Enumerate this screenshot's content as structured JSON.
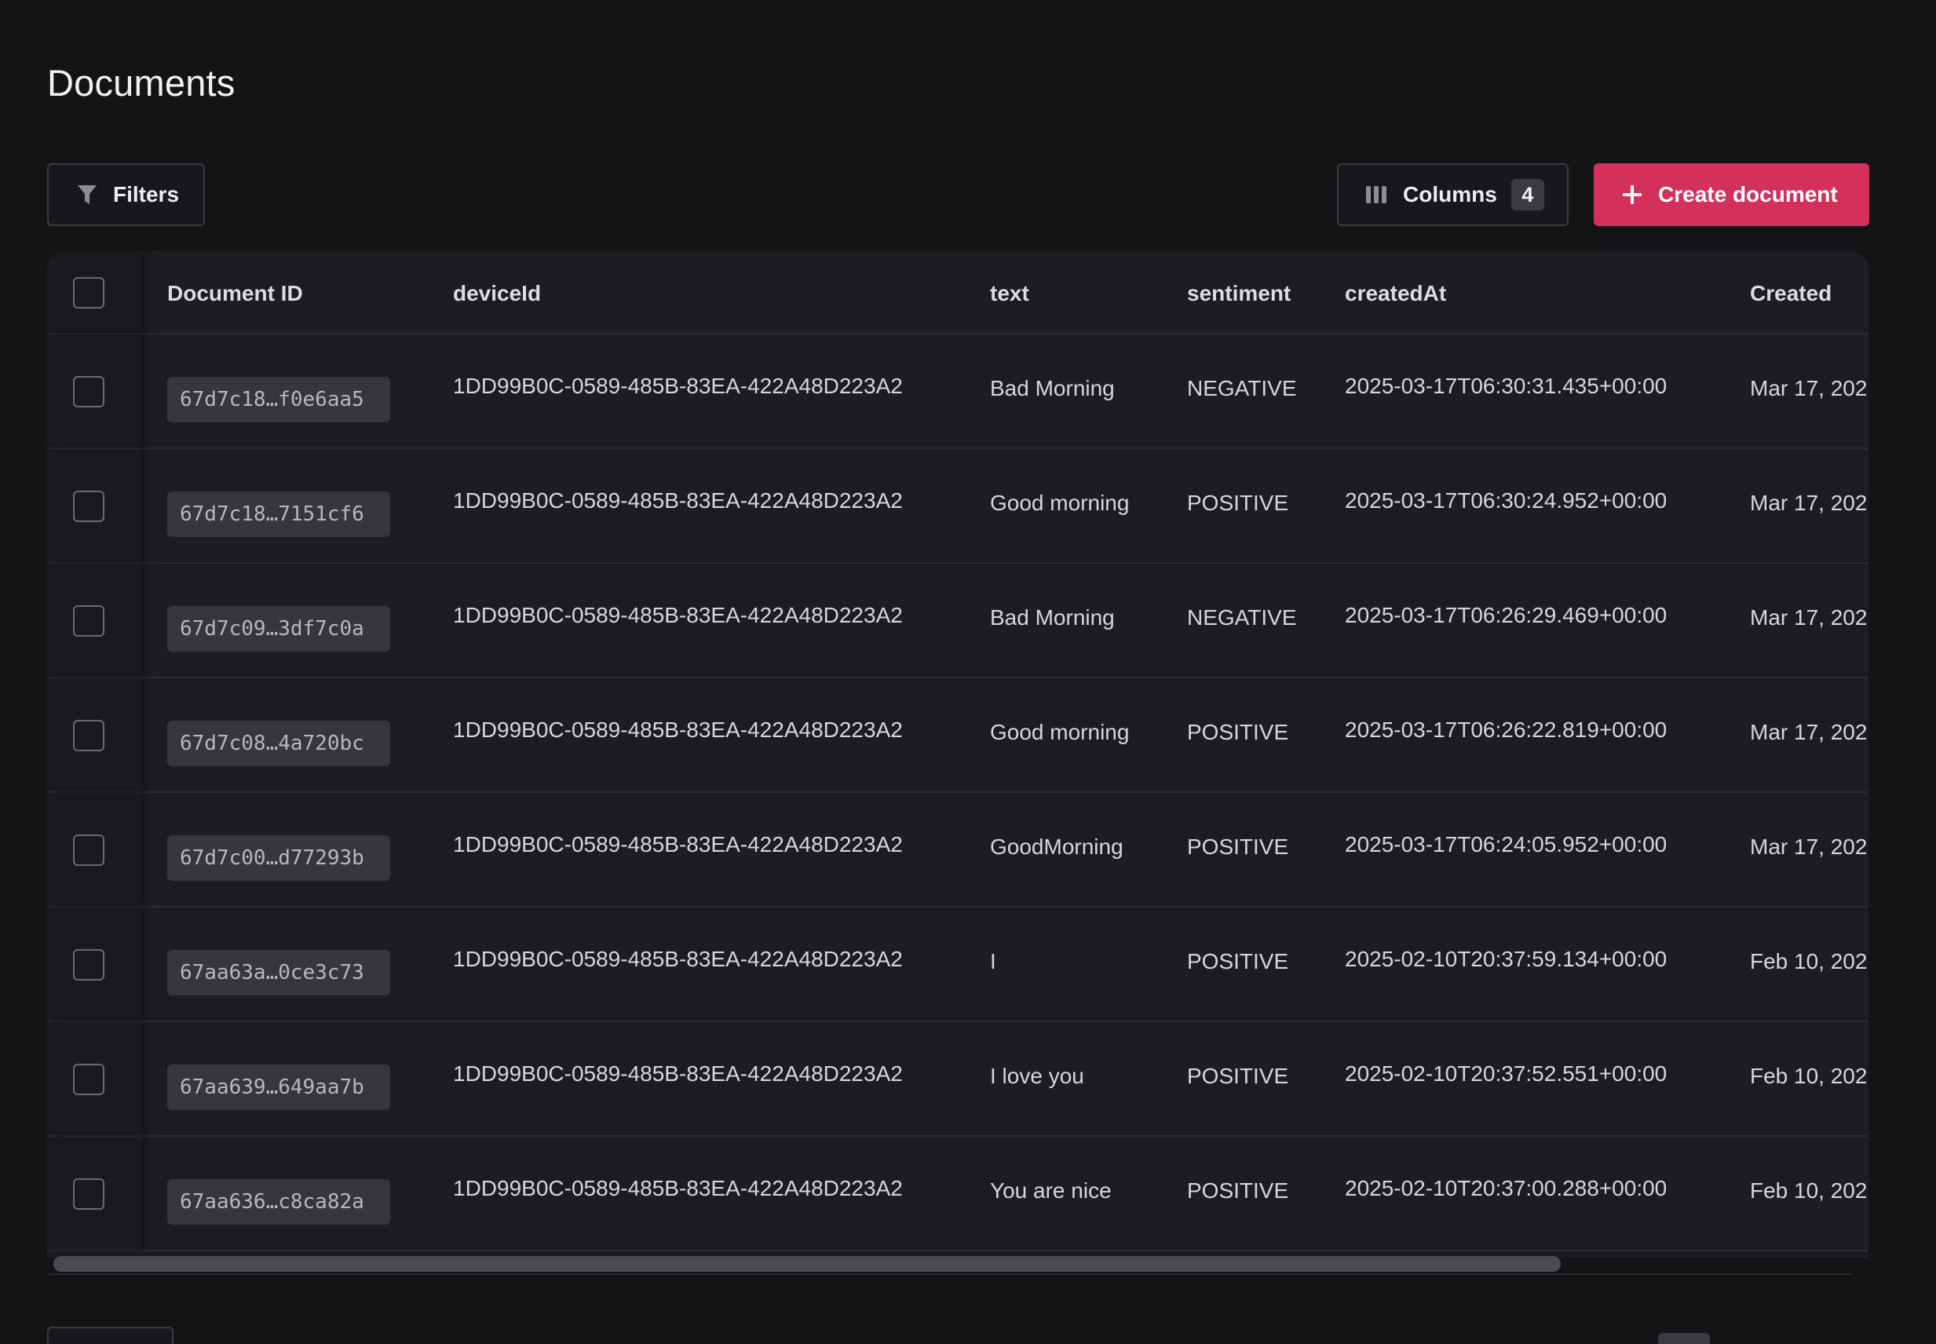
{
  "page": {
    "title": "Documents"
  },
  "toolbar": {
    "filters_label": "Filters",
    "columns_label": "Columns",
    "columns_count": "4",
    "create_label": "Create document"
  },
  "table": {
    "columns": [
      "Document ID",
      "deviceId",
      "text",
      "sentiment",
      "createdAt",
      "Created"
    ],
    "rows": [
      {
        "id": "67d7c18…f0e6aa5",
        "deviceId": "1DD99B0C-0589-485B-83EA-422A48D223A2",
        "text": "Bad Morning",
        "sentiment": "NEGATIVE",
        "createdAt": "2025-03-17T06:30:31.435+00:00",
        "created": "Mar 17, 202"
      },
      {
        "id": "67d7c18…7151cf6",
        "deviceId": "1DD99B0C-0589-485B-83EA-422A48D223A2",
        "text": "Good morning",
        "sentiment": "POSITIVE",
        "createdAt": "2025-03-17T06:30:24.952+00:00",
        "created": "Mar 17, 202"
      },
      {
        "id": "67d7c09…3df7c0a",
        "deviceId": "1DD99B0C-0589-485B-83EA-422A48D223A2",
        "text": "Bad Morning",
        "sentiment": "NEGATIVE",
        "createdAt": "2025-03-17T06:26:29.469+00:00",
        "created": "Mar 17, 202"
      },
      {
        "id": "67d7c08…4a720bc",
        "deviceId": "1DD99B0C-0589-485B-83EA-422A48D223A2",
        "text": "Good morning",
        "sentiment": "POSITIVE",
        "createdAt": "2025-03-17T06:26:22.819+00:00",
        "created": "Mar 17, 202"
      },
      {
        "id": "67d7c00…d77293b",
        "deviceId": "1DD99B0C-0589-485B-83EA-422A48D223A2",
        "text": "GoodMorning",
        "sentiment": "POSITIVE",
        "createdAt": "2025-03-17T06:24:05.952+00:00",
        "created": "Mar 17, 202"
      },
      {
        "id": "67aa63a…0ce3c73",
        "deviceId": "1DD99B0C-0589-485B-83EA-422A48D223A2",
        "text": "I",
        "sentiment": "POSITIVE",
        "createdAt": "2025-02-10T20:37:59.134+00:00",
        "created": "Feb 10, 202"
      },
      {
        "id": "67aa639…649aa7b",
        "deviceId": "1DD99B0C-0589-485B-83EA-422A48D223A2",
        "text": "I love you",
        "sentiment": "POSITIVE",
        "createdAt": "2025-02-10T20:37:52.551+00:00",
        "created": "Feb 10, 202"
      },
      {
        "id": "67aa636…c8ca82a",
        "deviceId": "1DD99B0C-0589-485B-83EA-422A48D223A2",
        "text": "You are nice",
        "sentiment": "POSITIVE",
        "createdAt": "2025-02-10T20:37:00.288+00:00",
        "created": "Feb 10, 202"
      }
    ]
  },
  "icons": {
    "filters": "funnel-icon",
    "columns": "columns-icon",
    "create": "plus-icon"
  },
  "colors": {
    "background": "#141417",
    "table_background": "#1c1c21",
    "accent": "#d3305c",
    "chip": "#36363d"
  }
}
